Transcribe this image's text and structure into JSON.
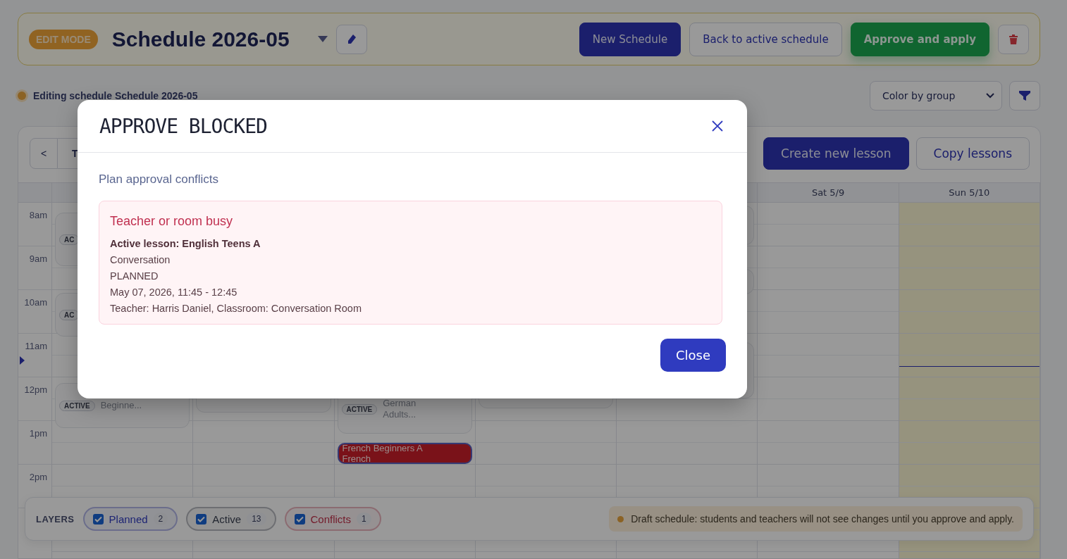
{
  "header": {
    "mode_badge": "EDIT MODE",
    "title": "Schedule 2026-05",
    "buttons": [
      {
        "label": "New Schedule",
        "kind": "primary"
      },
      {
        "label": "Back to active schedule",
        "kind": "outline"
      },
      {
        "label": "Approve and apply",
        "kind": "success"
      }
    ]
  },
  "status": {
    "text": "Editing schedule Schedule 2026-05"
  },
  "color_select": {
    "value": "Color by group"
  },
  "calendar": {
    "prev_button": "<",
    "today_button": "T",
    "actions": [
      {
        "label": "Create new lesson",
        "kind": "primary"
      },
      {
        "label": "Copy lessons",
        "kind": "outline"
      }
    ],
    "times": [
      "8am",
      "9am",
      "10am",
      "11am",
      "12pm",
      "1pm",
      "2pm"
    ],
    "days": [
      {
        "highlighted": false,
        "events": [
          {
            "kind": "active",
            "badge": "AC"
          },
          {
            "kind": "active",
            "badge": "AC"
          },
          {
            "kind": "active",
            "badge": "ACTIVE",
            "title": "Beginne..."
          }
        ]
      },
      {
        "highlighted": false,
        "events": [
          {
            "kind": "active"
          }
        ]
      },
      {
        "highlighted": false,
        "events": [
          {
            "kind": "active",
            "badge": "ACTIVE",
            "title": "German Adults..."
          },
          {
            "kind": "conflict",
            "title": "French Beginners A",
            "subtitle": "French"
          }
        ]
      },
      {
        "highlighted": false,
        "events": [
          {
            "kind": "active"
          }
        ]
      },
      {
        "highlighted": false,
        "events": [
          {
            "kind": "active"
          },
          {
            "kind": "active"
          },
          {
            "kind": "active"
          }
        ]
      },
      {
        "header": "Sat 5/9",
        "highlighted": false
      },
      {
        "header": "Sun 5/10",
        "highlighted": true
      }
    ]
  },
  "layers": {
    "label": "LAYERS",
    "items": [
      {
        "kind": "planned",
        "label": "Planned",
        "count": "2",
        "checked": true
      },
      {
        "kind": "active",
        "label": "Active",
        "count": "13",
        "checked": true
      },
      {
        "kind": "conflicts",
        "label": "Conflicts",
        "count": "1",
        "checked": true
      }
    ],
    "notice": "Draft schedule: students and teachers will not see changes until you approve and apply."
  },
  "modal": {
    "title": "APPROVE BLOCKED",
    "subtitle": "Plan approval conflicts",
    "conflict": {
      "heading": "Teacher or room busy",
      "lesson": "Active lesson: English Teens A",
      "lines": [
        "Conversation",
        "PLANNED",
        "May 07, 2026, 11:45 - 12:45",
        "Teacher: Harris Daniel, Classroom: Conversation Room"
      ]
    },
    "close_button": "Close"
  }
}
